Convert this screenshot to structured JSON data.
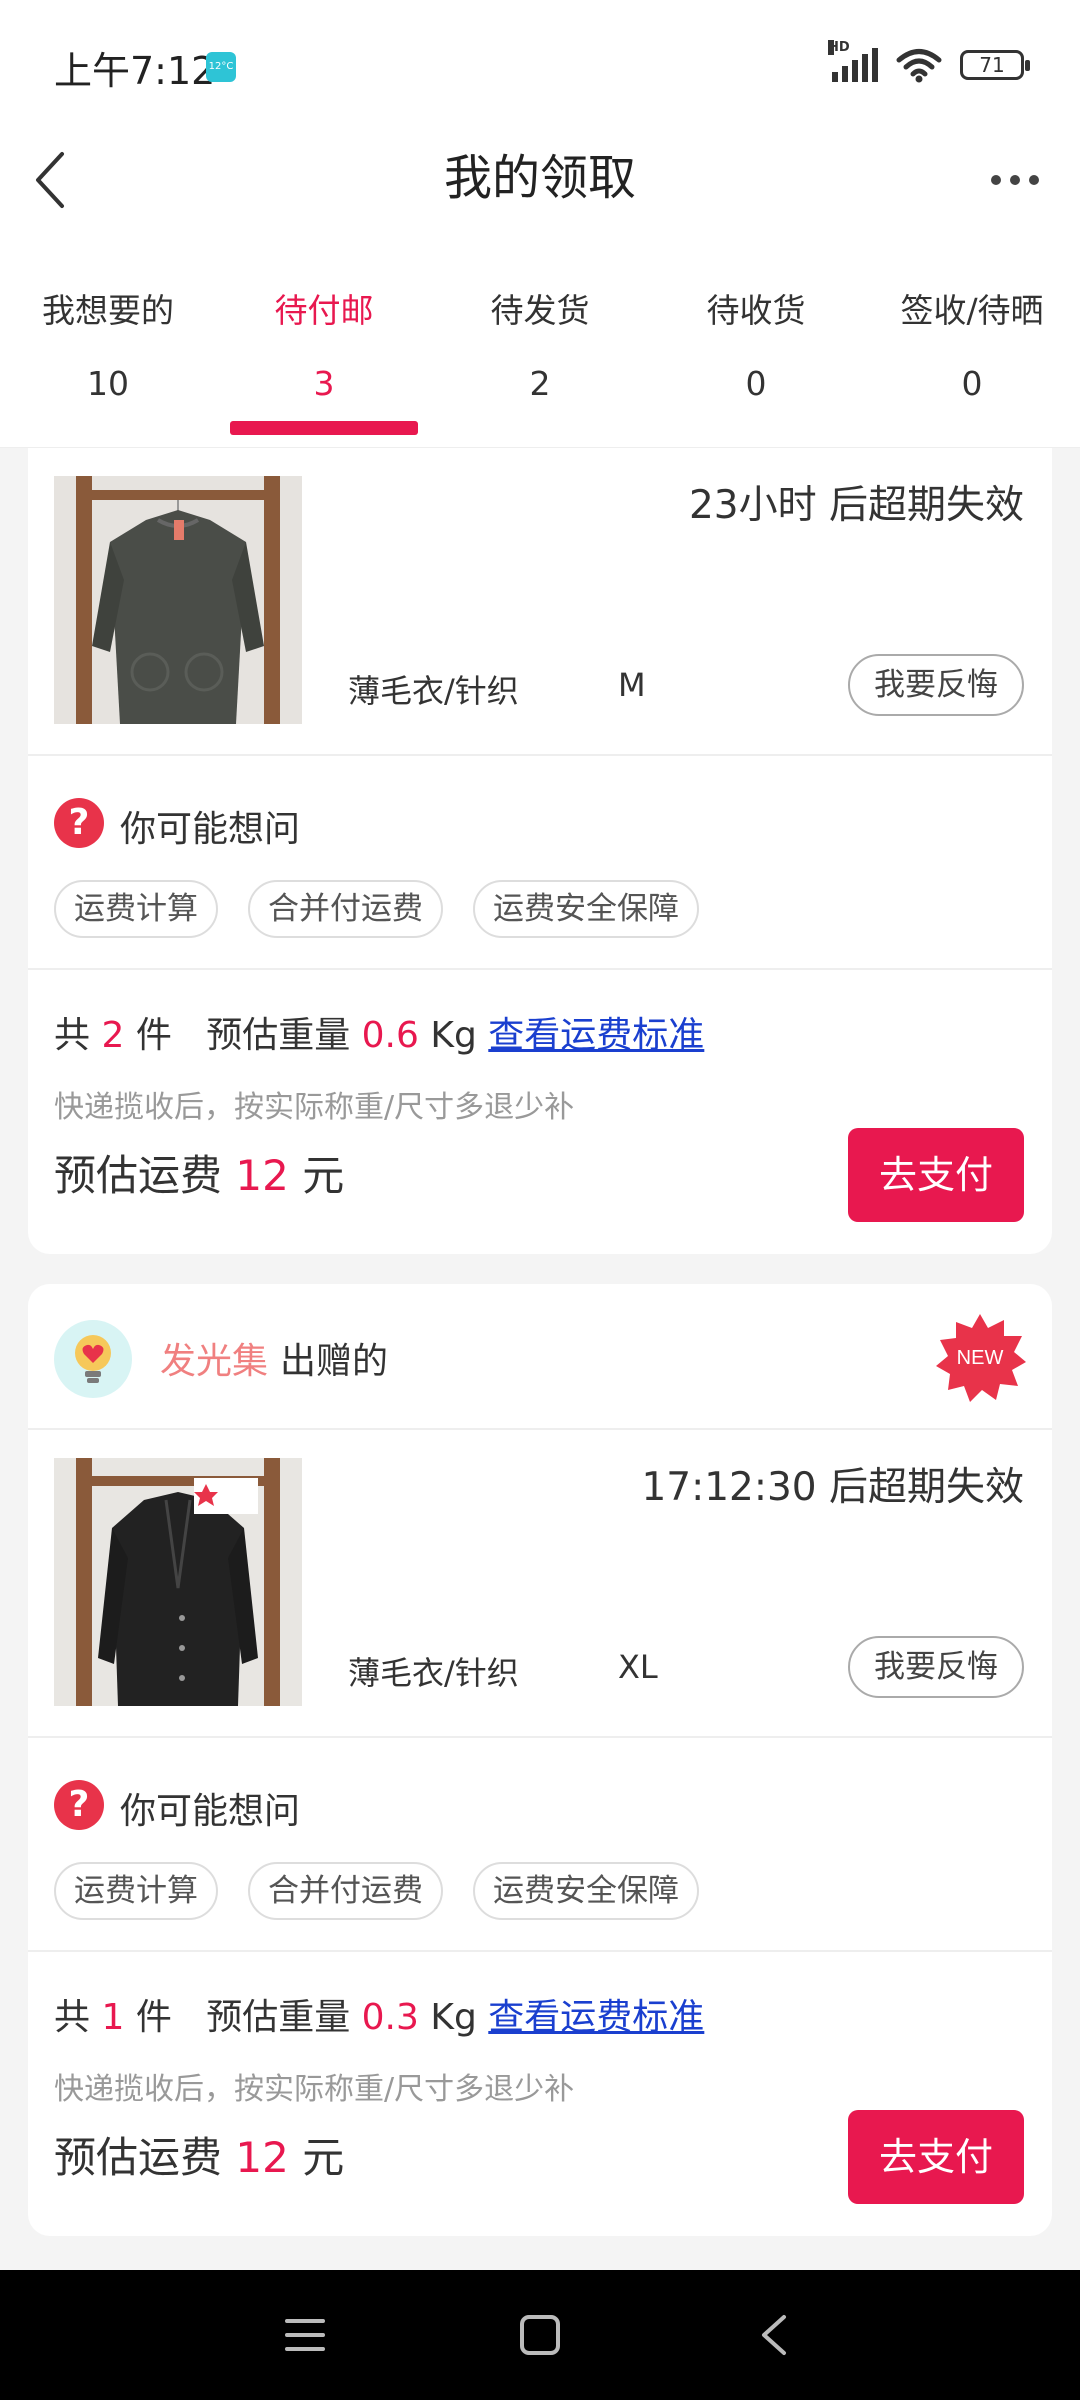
{
  "status_bar": {
    "time": "上午7:12",
    "weather_temp": "12°C",
    "network": "HD",
    "battery": "71"
  },
  "header": {
    "title": "我的领取"
  },
  "tabs": [
    {
      "label": "我想要的",
      "count": "10",
      "active": false
    },
    {
      "label": "待付邮",
      "count": "3",
      "active": true
    },
    {
      "label": "待发货",
      "count": "2",
      "active": false
    },
    {
      "label": "待收货",
      "count": "0",
      "active": false
    },
    {
      "label": "签收/待晒",
      "count": "0",
      "active": false
    }
  ],
  "colors": {
    "accent": "#e8184f",
    "link": "#1a3fcf",
    "seller": "#f08080"
  },
  "orders": [
    {
      "item": {
        "expiry": "23小时 后超期失效",
        "category": "薄毛衣/针织",
        "size": "M",
        "regret_label": "我要反悔",
        "photo_icon": "grey-knit-sweater-photo"
      },
      "faq": {
        "title": "你可能想问",
        "chips": [
          "运费计算",
          "合并付运费",
          "运费安全保障"
        ]
      },
      "summary": {
        "prefix": "共",
        "count": "2",
        "unit": "件",
        "weight_label": "预估重量",
        "weight": "0.6",
        "weight_unit": "Kg",
        "link": "查看运费标准",
        "note": "快递揽收后，按实际称重/尺寸多退少补",
        "fee_label": "预估运费",
        "fee": "12",
        "fee_unit": "元",
        "pay_label": "去支付"
      }
    },
    {
      "seller": {
        "name": "发光集",
        "suffix": "出赠的",
        "badge": "NEW",
        "avatar_icon": "lightbulb-heart-icon"
      },
      "item": {
        "expiry": "17:12:30 后超期失效",
        "category": "薄毛衣/针织",
        "size": "XL",
        "regret_label": "我要反悔",
        "photo_icon": "black-long-cardigan-photo"
      },
      "faq": {
        "title": "你可能想问",
        "chips": [
          "运费计算",
          "合并付运费",
          "运费安全保障"
        ]
      },
      "summary": {
        "prefix": "共",
        "count": "1",
        "unit": "件",
        "weight_label": "预估重量",
        "weight": "0.3",
        "weight_unit": "Kg",
        "link": "查看运费标准",
        "note": "快递揽收后，按实际称重/尺寸多退少补",
        "fee_label": "预估运费",
        "fee": "12",
        "fee_unit": "元",
        "pay_label": "去支付"
      }
    }
  ]
}
